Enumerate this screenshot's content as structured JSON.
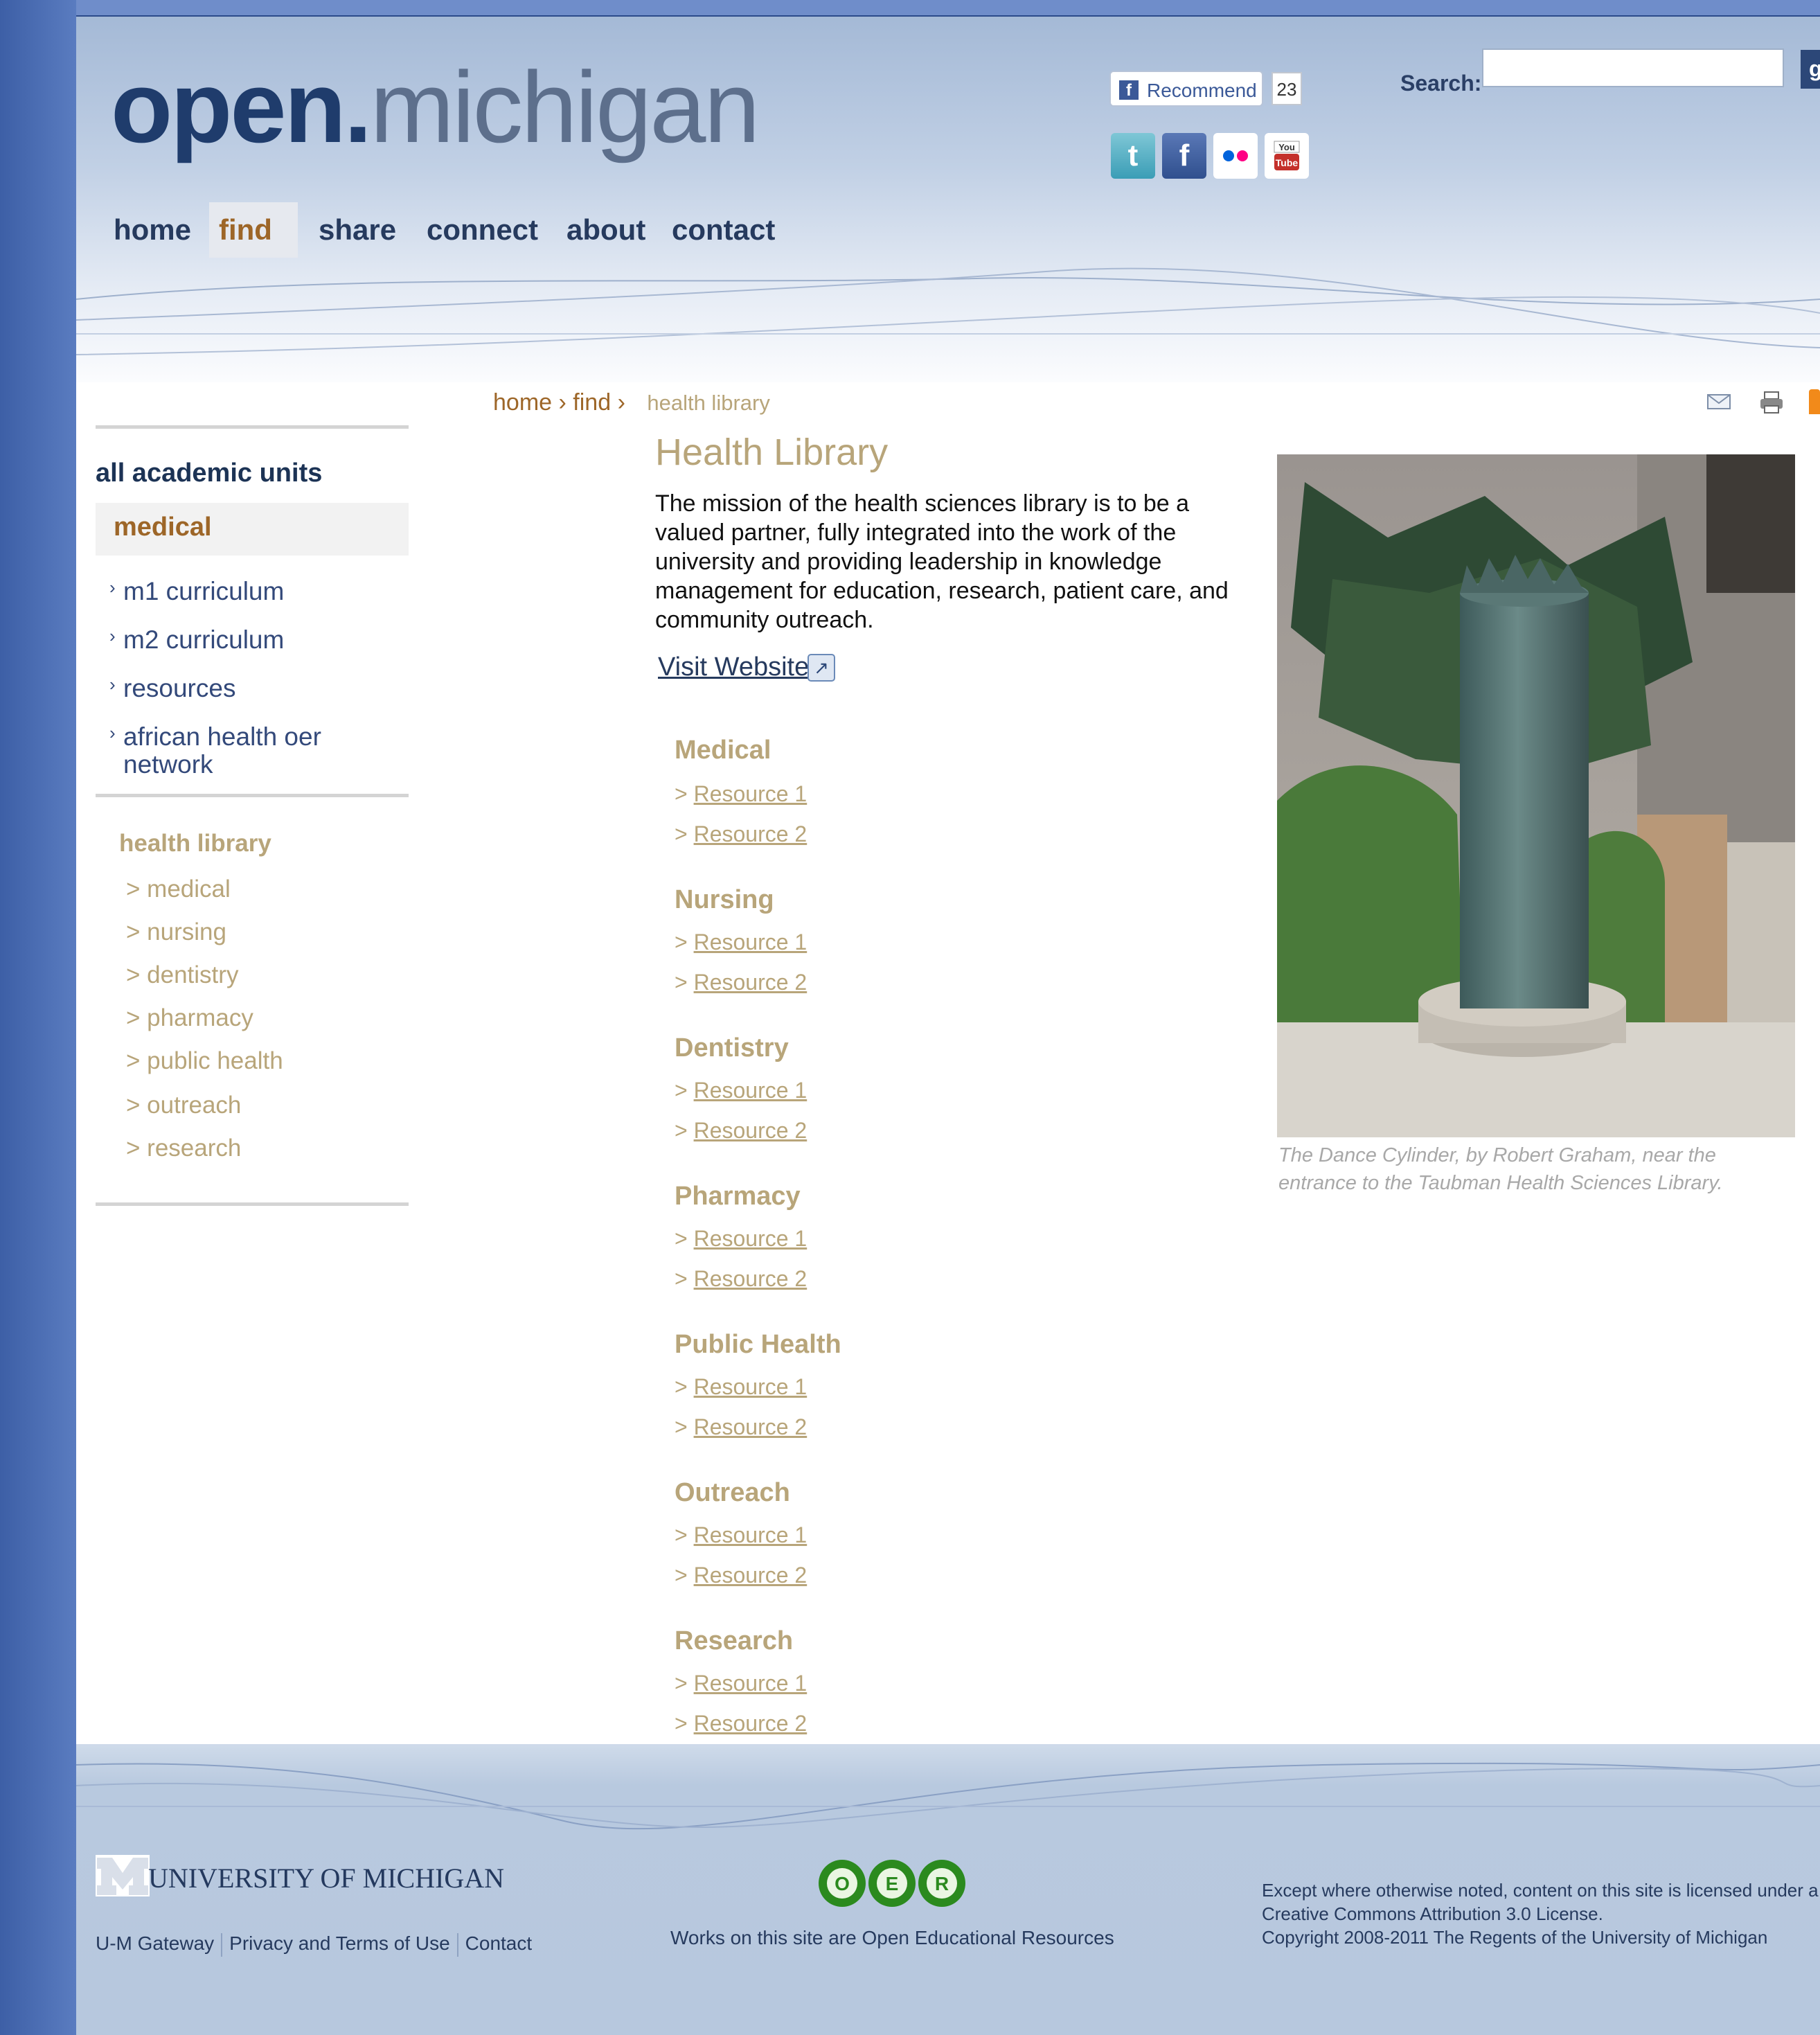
{
  "brand": {
    "logo_part1": "open.",
    "logo_part2": "michigan"
  },
  "social": {
    "recommend_label": "Recommend",
    "recommend_count": "23",
    "icons": [
      "twitter-icon",
      "facebook-icon",
      "flickr-icon",
      "youtube-icon"
    ]
  },
  "search": {
    "label": "Search:",
    "value": "",
    "go_label": "g"
  },
  "nav": {
    "items": [
      "home",
      "find",
      "share",
      "connect",
      "about",
      "contact"
    ],
    "active": "find"
  },
  "breadcrumb": {
    "home": "home",
    "find": "find",
    "sep": "›",
    "current": "health library"
  },
  "sidebar": {
    "units_label": "all academic units",
    "active_unit": "medical",
    "sub_items": [
      "m1 curriculum",
      "m2 curriculum",
      "resources",
      "african health oer network"
    ],
    "health_title": "health library",
    "health_items": [
      "> medical",
      "> nursing",
      "> dentistry",
      "> pharmacy",
      "> public health",
      "> outreach",
      "> research"
    ]
  },
  "main": {
    "title": "Health Library",
    "mission": "The mission of the health sciences library is to be a valued partner, fully integrated into the work of the university and providing leadership in knowledge management for education, research, patient care, and community outreach.",
    "visit_label": "Visit Website",
    "sections": [
      {
        "heading": "Medical",
        "r1": "Resource 1",
        "r2": "Resource 2"
      },
      {
        "heading": "Nursing",
        "r1": "Resource 1",
        "r2": "Resource 2"
      },
      {
        "heading": "Dentistry",
        "r1": "Resource 1",
        "r2": "Resource 2"
      },
      {
        "heading": "Pharmacy",
        "r1": "Resource 1",
        "r2": "Resource 2"
      },
      {
        "heading": "Public Health",
        "r1": "Resource 1",
        "r2": "Resource 2"
      },
      {
        "heading": "Outreach",
        "r1": "Resource 1",
        "r2": "Resource 2"
      },
      {
        "heading": "Research",
        "r1": "Resource 1",
        "r2": "Resource 2"
      }
    ],
    "res_prefix": ">",
    "caption": "The Dance Cylinder, by Robert Graham, near the entrance to the Taubman Health Sciences Library."
  },
  "footer": {
    "um_name": "UNIVERSITY OF MICHIGAN",
    "links": [
      "U-M Gateway",
      "Privacy and Terms of Use",
      "Contact"
    ],
    "oer_text": "Works on this site are Open Educational Resources",
    "license_line1": "Except where otherwise noted, content on this site is licensed under a Creative Commons Attribution 3.0 License.",
    "license_line2": "Copyright 2008-2011 The Regents of the University of Michigan"
  },
  "colors": {
    "brand_dark": "#1f3c6c",
    "accent_brown": "#9d6628",
    "muted_tan": "#b8a57a",
    "side_blue": "#3d5fa6"
  }
}
